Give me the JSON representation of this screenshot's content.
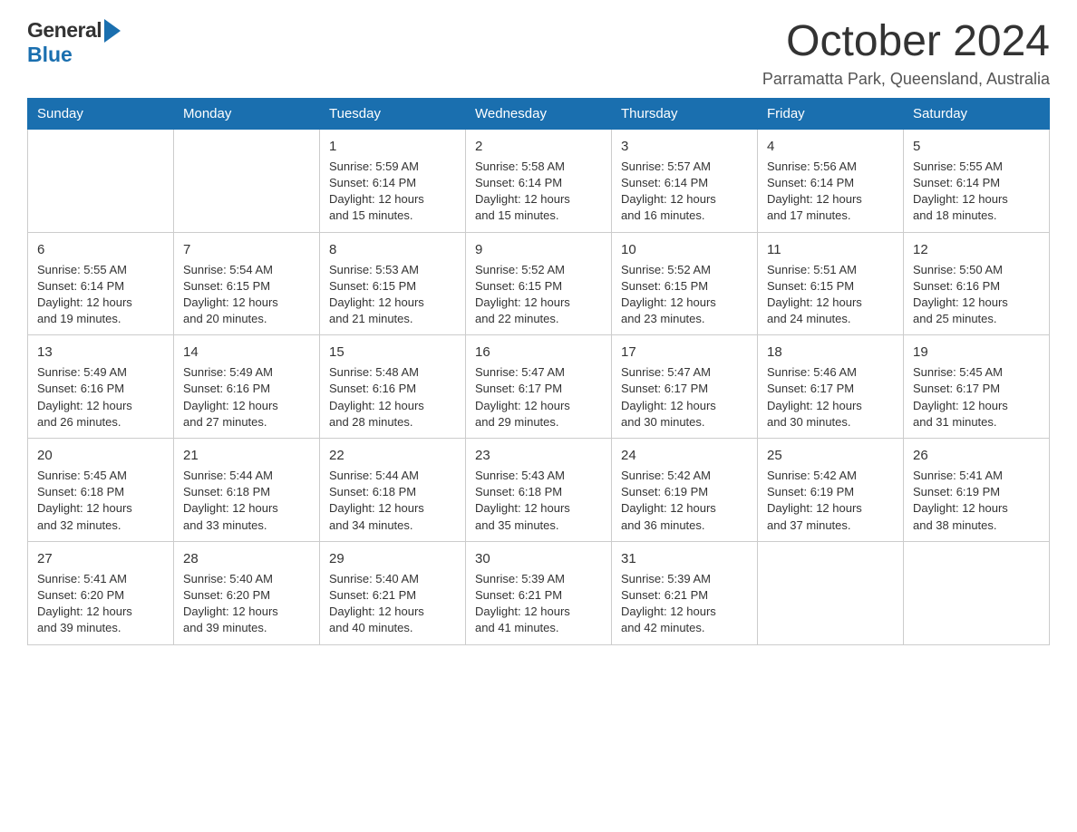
{
  "header": {
    "title": "October 2024",
    "location": "Parramatta Park, Queensland, Australia",
    "logo_general": "General",
    "logo_blue": "Blue"
  },
  "days_of_week": [
    "Sunday",
    "Monday",
    "Tuesday",
    "Wednesday",
    "Thursday",
    "Friday",
    "Saturday"
  ],
  "weeks": [
    [
      {
        "day": "",
        "info": ""
      },
      {
        "day": "",
        "info": ""
      },
      {
        "day": "1",
        "info": "Sunrise: 5:59 AM\nSunset: 6:14 PM\nDaylight: 12 hours\nand 15 minutes."
      },
      {
        "day": "2",
        "info": "Sunrise: 5:58 AM\nSunset: 6:14 PM\nDaylight: 12 hours\nand 15 minutes."
      },
      {
        "day": "3",
        "info": "Sunrise: 5:57 AM\nSunset: 6:14 PM\nDaylight: 12 hours\nand 16 minutes."
      },
      {
        "day": "4",
        "info": "Sunrise: 5:56 AM\nSunset: 6:14 PM\nDaylight: 12 hours\nand 17 minutes."
      },
      {
        "day": "5",
        "info": "Sunrise: 5:55 AM\nSunset: 6:14 PM\nDaylight: 12 hours\nand 18 minutes."
      }
    ],
    [
      {
        "day": "6",
        "info": "Sunrise: 5:55 AM\nSunset: 6:14 PM\nDaylight: 12 hours\nand 19 minutes."
      },
      {
        "day": "7",
        "info": "Sunrise: 5:54 AM\nSunset: 6:15 PM\nDaylight: 12 hours\nand 20 minutes."
      },
      {
        "day": "8",
        "info": "Sunrise: 5:53 AM\nSunset: 6:15 PM\nDaylight: 12 hours\nand 21 minutes."
      },
      {
        "day": "9",
        "info": "Sunrise: 5:52 AM\nSunset: 6:15 PM\nDaylight: 12 hours\nand 22 minutes."
      },
      {
        "day": "10",
        "info": "Sunrise: 5:52 AM\nSunset: 6:15 PM\nDaylight: 12 hours\nand 23 minutes."
      },
      {
        "day": "11",
        "info": "Sunrise: 5:51 AM\nSunset: 6:15 PM\nDaylight: 12 hours\nand 24 minutes."
      },
      {
        "day": "12",
        "info": "Sunrise: 5:50 AM\nSunset: 6:16 PM\nDaylight: 12 hours\nand 25 minutes."
      }
    ],
    [
      {
        "day": "13",
        "info": "Sunrise: 5:49 AM\nSunset: 6:16 PM\nDaylight: 12 hours\nand 26 minutes."
      },
      {
        "day": "14",
        "info": "Sunrise: 5:49 AM\nSunset: 6:16 PM\nDaylight: 12 hours\nand 27 minutes."
      },
      {
        "day": "15",
        "info": "Sunrise: 5:48 AM\nSunset: 6:16 PM\nDaylight: 12 hours\nand 28 minutes."
      },
      {
        "day": "16",
        "info": "Sunrise: 5:47 AM\nSunset: 6:17 PM\nDaylight: 12 hours\nand 29 minutes."
      },
      {
        "day": "17",
        "info": "Sunrise: 5:47 AM\nSunset: 6:17 PM\nDaylight: 12 hours\nand 30 minutes."
      },
      {
        "day": "18",
        "info": "Sunrise: 5:46 AM\nSunset: 6:17 PM\nDaylight: 12 hours\nand 30 minutes."
      },
      {
        "day": "19",
        "info": "Sunrise: 5:45 AM\nSunset: 6:17 PM\nDaylight: 12 hours\nand 31 minutes."
      }
    ],
    [
      {
        "day": "20",
        "info": "Sunrise: 5:45 AM\nSunset: 6:18 PM\nDaylight: 12 hours\nand 32 minutes."
      },
      {
        "day": "21",
        "info": "Sunrise: 5:44 AM\nSunset: 6:18 PM\nDaylight: 12 hours\nand 33 minutes."
      },
      {
        "day": "22",
        "info": "Sunrise: 5:44 AM\nSunset: 6:18 PM\nDaylight: 12 hours\nand 34 minutes."
      },
      {
        "day": "23",
        "info": "Sunrise: 5:43 AM\nSunset: 6:18 PM\nDaylight: 12 hours\nand 35 minutes."
      },
      {
        "day": "24",
        "info": "Sunrise: 5:42 AM\nSunset: 6:19 PM\nDaylight: 12 hours\nand 36 minutes."
      },
      {
        "day": "25",
        "info": "Sunrise: 5:42 AM\nSunset: 6:19 PM\nDaylight: 12 hours\nand 37 minutes."
      },
      {
        "day": "26",
        "info": "Sunrise: 5:41 AM\nSunset: 6:19 PM\nDaylight: 12 hours\nand 38 minutes."
      }
    ],
    [
      {
        "day": "27",
        "info": "Sunrise: 5:41 AM\nSunset: 6:20 PM\nDaylight: 12 hours\nand 39 minutes."
      },
      {
        "day": "28",
        "info": "Sunrise: 5:40 AM\nSunset: 6:20 PM\nDaylight: 12 hours\nand 39 minutes."
      },
      {
        "day": "29",
        "info": "Sunrise: 5:40 AM\nSunset: 6:21 PM\nDaylight: 12 hours\nand 40 minutes."
      },
      {
        "day": "30",
        "info": "Sunrise: 5:39 AM\nSunset: 6:21 PM\nDaylight: 12 hours\nand 41 minutes."
      },
      {
        "day": "31",
        "info": "Sunrise: 5:39 AM\nSunset: 6:21 PM\nDaylight: 12 hours\nand 42 minutes."
      },
      {
        "day": "",
        "info": ""
      },
      {
        "day": "",
        "info": ""
      }
    ]
  ]
}
